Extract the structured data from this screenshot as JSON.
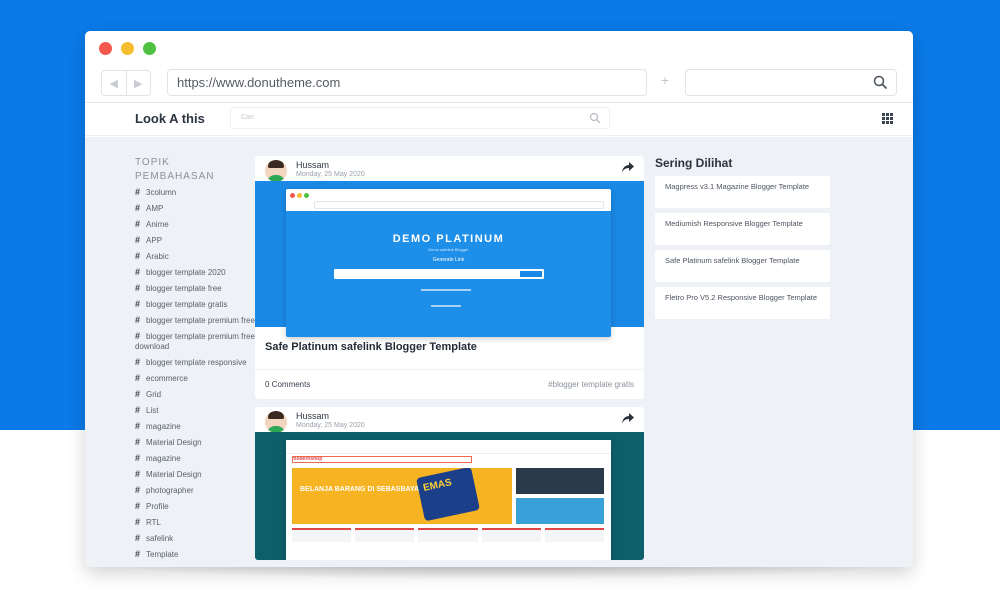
{
  "browser": {
    "url": "https://www.donutheme.com",
    "search_value": ""
  },
  "site": {
    "title": "Look A this",
    "search_placeholder": "Cari"
  },
  "sidebar": {
    "title_line1": "TOPIK",
    "title_line2": "PEMBAHASAN",
    "tags": [
      "3column",
      "AMP",
      "Anime",
      "APP",
      "Arabic",
      "blogger template 2020",
      "blogger template free",
      "blogger template gratis",
      "blogger template premium free",
      "blogger template premium free download",
      "blogger template responsive",
      "ecommerce",
      "Grid",
      "List",
      "magazine",
      "Material Design",
      "magazine",
      "Material Design",
      "photographer",
      "Profile",
      "RTL",
      "safelink",
      "Template"
    ]
  },
  "posts": [
    {
      "author": "Hussam",
      "date": "Monday, 25 May 2020",
      "thumb_title": "DEMO PLATINUM",
      "thumb_sub": "Demo safelink Blogger",
      "thumb_gen": "Generate Link",
      "title": "Safe Platinum safelink Blogger Template",
      "comments": "0 Comments",
      "category": "#blogger template gratis"
    },
    {
      "author": "Hussam",
      "date": "Monday, 25 May 2020",
      "shop_logo": "modernshop",
      "banner_text": "BELANJA BARANG DI SEBASBAYAR",
      "banner_gold": "EMAS"
    }
  ],
  "popular": {
    "title": "Sering Dilihat",
    "items": [
      "Magpress v3.1 Magazine Blogger Template",
      "Mediumish Responsive Blogger Template",
      "Safe Platinum safelink Blogger Template",
      "Fletro Pro V5.2 Responsive Blogger Template"
    ]
  },
  "colors": {
    "background_blue": "#0a7ae8",
    "thumb_blue": "#1a88e5",
    "thumb_teal": "#0d5f6c"
  }
}
